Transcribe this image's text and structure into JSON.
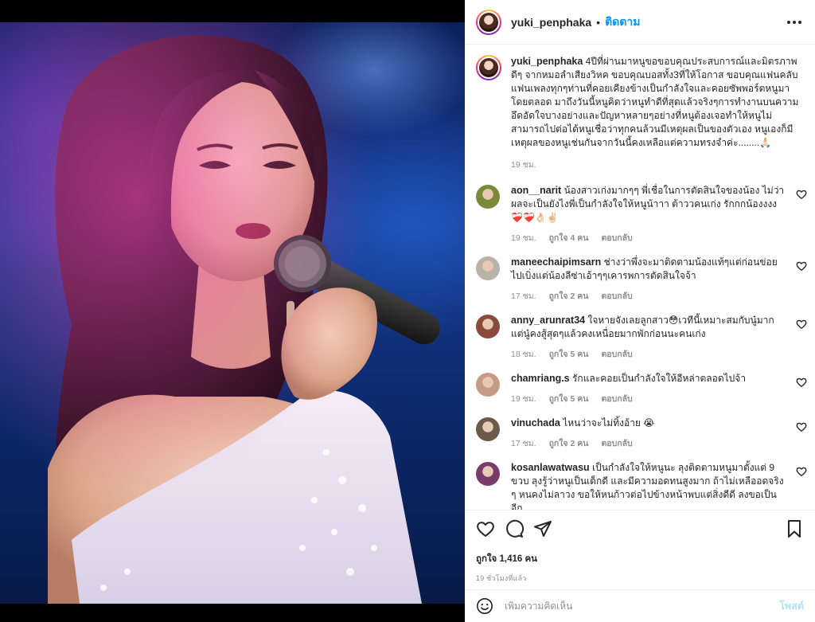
{
  "post": {
    "author": "yuki_penphaka",
    "follow_label": "ติดตาม",
    "caption": "4ปีที่ผ่านมาหนูขอขอบคุณประสบการณ์และมิตรภาพดีๆ จากหมอลำเสียงวิหค ขอบคุณบอสทั้ง3ที่ให้โอกาส ขอบคุณแฟนคลับแฟนเพลงทุกๆท่านที่คอยเคียงข้างเป็นกำลังใจและคอยซัพพอร์ตหนูมาโดยตลอด มาถึงวันนี้หนูคิดว่าหนูทำดีที่สุดแล้วจริงๆการทำงานบนความอึดอัดใจบางอย่างและปัญหาหลายๆอย่างที่หนูต้องเจอทำให้หนูไม่สามารถไปต่อได้หนูเชื่อว่าทุกคนล้วนมีเหตุผลเป็นของตัวเอง หนูเองก็มีเหตุผลของหนูเช่นกันจากวันนี้คงเหลือแต่ความทรงจำค่ะ........🙏🏻",
    "caption_time": "19 ชม."
  },
  "comments": [
    {
      "user": "aon__narit",
      "text": "น้องสาวเก่งมากๆๆ พี่เชื่อในการตัดสินใจของน้อง ไม่ว่าผลจะเป็นยังไงพี่เป็นกำลังใจให้หนูน้าาา ต้าววคนเก่ง รักกกน้องงงง ❤️‍🩹❤️‍🩹👌🏻✌🏻",
      "time": "19 ชม.",
      "likes": "ถูกใจ 4 คน",
      "reply": "ตอบกลับ",
      "avatar_color": "#7a8a3a"
    },
    {
      "user": "maneechaipimsarn",
      "text": "ช่างว่าพึ่งจะมาติดตามน้องแท้ๆแต่ก่อนข่อยไปเบิ่งแต่น้องลีซ่าเอ้าๆๆเคารพการตัดสินใจจ้า",
      "time": "17 ชม.",
      "likes": "ถูกใจ 2 คน",
      "reply": "ตอบกลับ",
      "avatar_color": "#b9b2a6"
    },
    {
      "user": "anny_arunrat34",
      "text": "ใจหายจังเลยลูกสาว😳เวทีนี้เหมาะสมกับนู๋มากแต่นู๋คงสู้สุดๆแล้วคงเหนื่อยมากพักก่อนนะคนเก่ง",
      "time": "18 ชม.",
      "likes": "ถูกใจ 5 คน",
      "reply": "ตอบกลับ",
      "avatar_color": "#8a4b3a"
    },
    {
      "user": "chamriang.s",
      "text": "รักและคอยเป็นกำลังใจให้อีหล่าตลอดไปจ้า",
      "time": "19 ชม.",
      "likes": "ถูกใจ 5 คน",
      "reply": "ตอบกลับ",
      "avatar_color": "#c79a85"
    },
    {
      "user": "vinuchada",
      "text": "ไหนว่าจะไม่ทิ้งอ้าย 😭",
      "time": "17 ชม.",
      "likes": "ถูกใจ 2 คน",
      "reply": "ตอบกลับ",
      "avatar_color": "#6b5a4a"
    },
    {
      "user": "kosanlawatwasu",
      "text": "เป็นกำลังใจให้หนูนะ ลุงติดตามหนูมาตั้งแต่ 9 ขวบ ลุงรู้ว่าหนูเป็นเด็กดี และมีความอดทนสูงมาก ถ้าไม่เหลืออดจริง ๆ หนคงไม่ลาวง ขอให้หนก้าวต่อไปข้างหน้าพบแต่สิ่งดีดี ลงขอเป็นอีก",
      "time": "",
      "likes": "",
      "reply": "",
      "avatar_color": "#7a3b6a"
    }
  ],
  "actions": {
    "likes_text": "ถูกใจ 1,416 คน",
    "time_ago": "19 ชั่วโมงที่แล้ว"
  },
  "add_comment": {
    "placeholder": "เพิ่มความคิดเห็น",
    "post_label": "โพสต์"
  },
  "icons": {
    "header_more": "more-horizontal-icon",
    "like": "heart-icon",
    "comment": "comment-icon",
    "share": "share-icon",
    "save": "bookmark-icon",
    "emoji": "emoji-icon"
  }
}
